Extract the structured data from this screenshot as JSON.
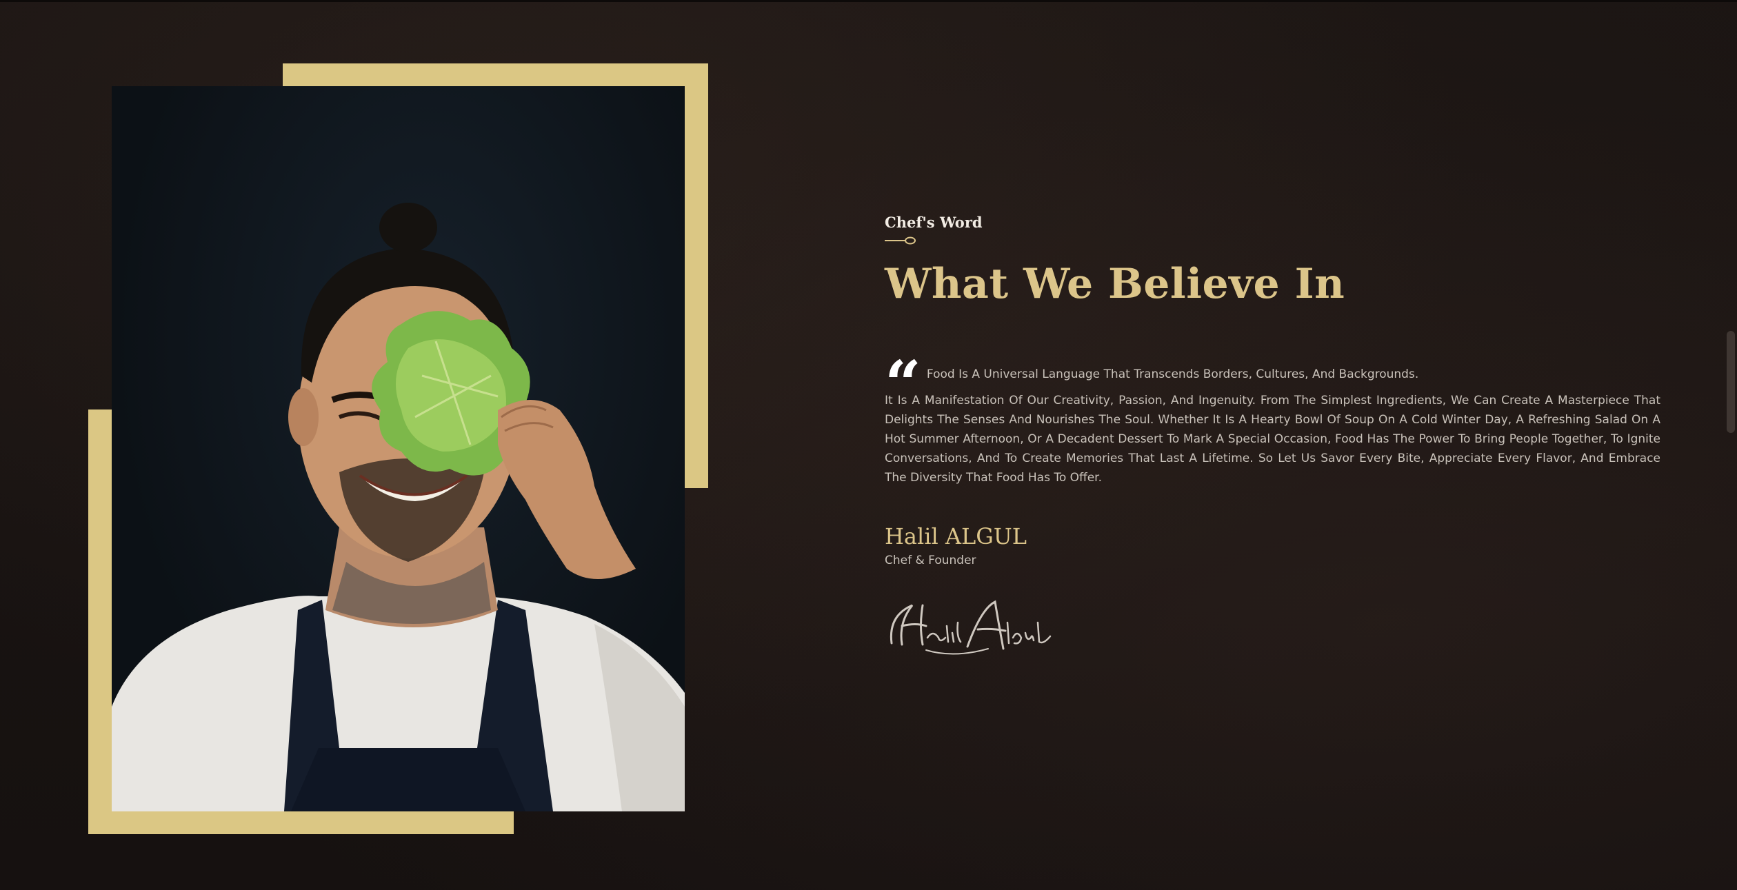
{
  "section": {
    "eyebrow": "Chef's Word",
    "title": "What We Believe In"
  },
  "quote": {
    "mark": "“",
    "lead": "Food Is A Universal Language That Transcends Borders, Cultures, And Backgrounds.",
    "body": "It Is A Manifestation Of Our Creativity, Passion, And Ingenuity. From The Simplest Ingredients, We Can Create A Masterpiece That Delights The Senses And Nourishes The Soul. Whether It Is A Hearty Bowl Of Soup On A Cold Winter Day, A Refreshing Salad On A Hot Summer Afternoon, Or A Decadent Dessert To Mark A Special Occasion, Food Has The Power To Bring People Together, To Ignite Conversations, And To Create Memories That Last A Lifetime. So Let Us Savor Every Bite, Appreciate Every Flavor, And Embrace The Diversity That Food Has To Offer."
  },
  "author": {
    "name": "Halil ALGUL",
    "role": "Chef & Founder",
    "signature": "Halil Algul"
  },
  "colors": {
    "background": "#1a1412",
    "accent_gold": "#dcc58a",
    "frame_gold": "#dbc784",
    "text": "#c9c2ba"
  },
  "icons": {
    "quote": "quote-icon",
    "divider": "whisk-divider-icon"
  }
}
